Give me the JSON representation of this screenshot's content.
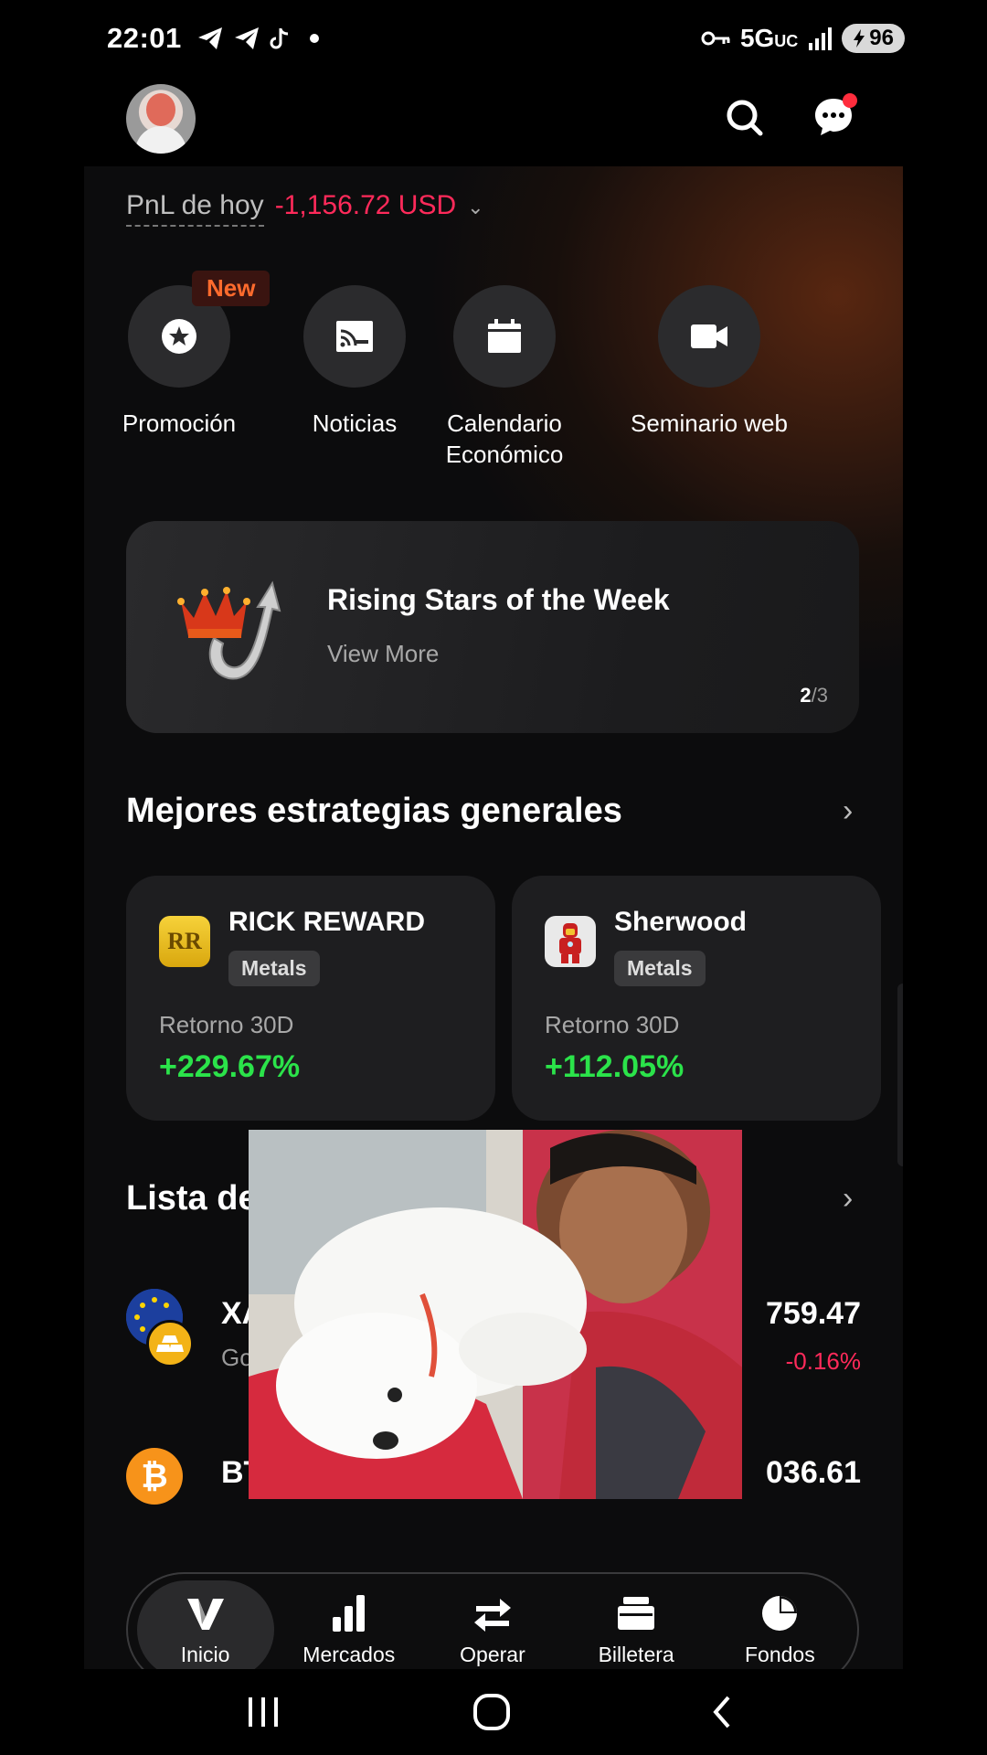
{
  "status_bar": {
    "time": "22:01",
    "network": "5G",
    "network_sub": "UC",
    "battery": "96",
    "left_icons": [
      "telegram-icon",
      "telegram-icon",
      "tiktok-icon",
      "dot-icon"
    ],
    "right_icons": [
      "vpn-key-icon",
      "signal-icon",
      "battery-charging-icon"
    ]
  },
  "header": {
    "search_icon": "search-icon",
    "chat_icon": "chat-bubble-icon",
    "has_notification": true
  },
  "pnl": {
    "label": "PnL de hoy",
    "value": "-1,156.72 USD",
    "value_color": "#ff2a5a"
  },
  "quick_actions": [
    {
      "label": "Promoción",
      "icon": "star-badge-icon",
      "badge": "New"
    },
    {
      "label": "Noticias",
      "icon": "news-cast-icon"
    },
    {
      "label": "Calendario Económico",
      "icon": "calendar-icon"
    },
    {
      "label": "Seminario web",
      "icon": "video-camera-icon"
    }
  ],
  "banner": {
    "title": "Rising Stars of the Week",
    "subtitle": "View More",
    "page_current": "2",
    "page_total": "/3"
  },
  "strategies": {
    "title": "Mejores estrategias generales",
    "cards": [
      {
        "name": "RICK REWARD",
        "tag": "Metals",
        "return_label": "Retorno 30D",
        "return_value": "+229.67%",
        "icon_text": "RR"
      },
      {
        "name": "Sherwood",
        "tag": "Metals",
        "return_label": "Retorno 30D",
        "return_value": "+112.05%",
        "icon": "ironman-avatar-icon"
      }
    ]
  },
  "watchlist": {
    "title": "Lista de",
    "rows": [
      {
        "symbol": "XA",
        "subtitle": "Go",
        "price": "759.47",
        "change": "-0.16%",
        "icon": "gold-eu-icon"
      },
      {
        "symbol": "BT",
        "subtitle": "",
        "price": "036.61",
        "change": "",
        "icon": "bitcoin-icon"
      }
    ]
  },
  "tabbar": {
    "tabs": [
      {
        "label": "Inicio",
        "icon": "home-v-logo-icon",
        "active": true
      },
      {
        "label": "Mercados",
        "icon": "bar-chart-icon"
      },
      {
        "label": "Operar",
        "icon": "swap-arrows-icon"
      },
      {
        "label": "Billetera",
        "icon": "wallet-icon"
      },
      {
        "label": "Fondos",
        "icon": "pie-chart-icon"
      }
    ]
  },
  "colors": {
    "negative": "#ff2a5a",
    "positive": "#2be34a",
    "badge_new": "#ff6b2d"
  }
}
